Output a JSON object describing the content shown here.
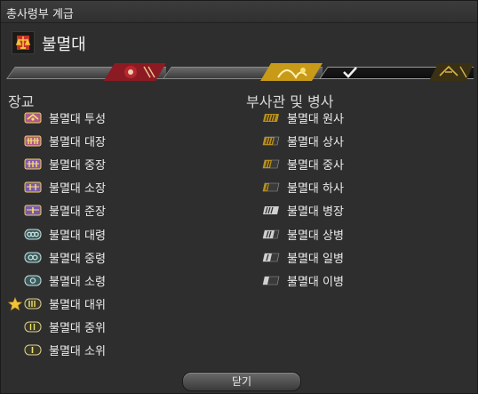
{
  "window": {
    "title": "총사령부 계급"
  },
  "header": {
    "name": "불멸대"
  },
  "tabs": [
    {
      "id": "maelstrom",
      "selected": false
    },
    {
      "id": "twin-adder",
      "selected": false
    },
    {
      "id": "immortal-flames",
      "selected": true
    }
  ],
  "officers": {
    "heading": "장교",
    "ranks": [
      {
        "label": "불멸대 투성",
        "current": false
      },
      {
        "label": "불멸대 대장",
        "current": false
      },
      {
        "label": "불멸대 중장",
        "current": false
      },
      {
        "label": "불멸대 소장",
        "current": false
      },
      {
        "label": "불멸대 준장",
        "current": false
      },
      {
        "label": "불멸대 대령",
        "current": false
      },
      {
        "label": "불멸대 중령",
        "current": false
      },
      {
        "label": "불멸대 소령",
        "current": false
      },
      {
        "label": "불멸대 대위",
        "current": true
      },
      {
        "label": "불멸대 중위",
        "current": false
      },
      {
        "label": "불멸대 소위",
        "current": false
      }
    ]
  },
  "enlisted": {
    "heading": "부사관 및 병사",
    "ranks": [
      {
        "label": "불멸대 원사"
      },
      {
        "label": "불멸대 상사"
      },
      {
        "label": "불멸대 중사"
      },
      {
        "label": "불멸대 하사"
      },
      {
        "label": "불멸대 병장"
      },
      {
        "label": "불멸대 상병"
      },
      {
        "label": "불멸대 일병"
      },
      {
        "label": "불멸대 이병"
      }
    ]
  },
  "footer": {
    "close_label": "닫기"
  },
  "colors": {
    "accent_gold": "#d8b24a",
    "pink_insignia": "#b05a8a",
    "purple_insignia": "#7a5aa8",
    "teal_insignia": "#7fb2b0"
  }
}
